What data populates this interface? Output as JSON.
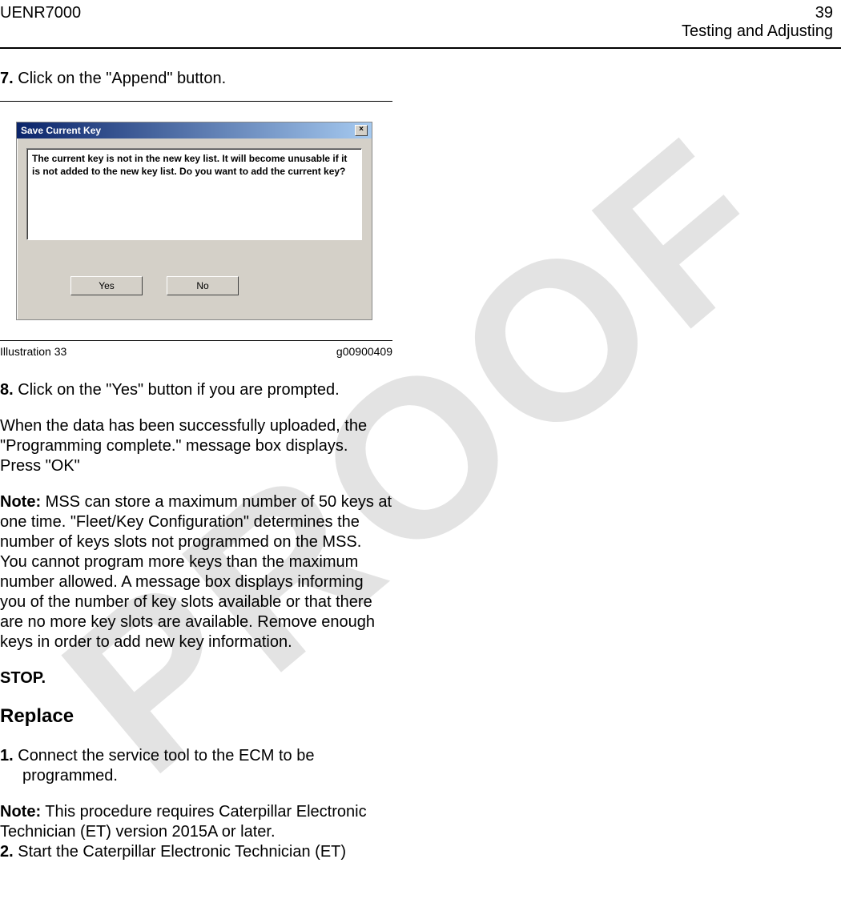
{
  "header": {
    "doc_id": "UENR7000",
    "page_number": "39",
    "section": "Testing and Adjusting"
  },
  "watermark": "PROOF",
  "step7": {
    "num": "7.",
    "text": " Click on the  \"Append\"  button."
  },
  "dialog": {
    "title": "Save Current Key",
    "close_symbol": "×",
    "message": "The current key is not in the new key list.  It will become unusable if it is not added to the new key list.  Do you want to add the current key?",
    "yes_label": "Yes",
    "no_label": "No"
  },
  "caption": {
    "left": "Illustration 33",
    "right": "g00900409"
  },
  "step8": {
    "num": "8.",
    "text": " Click on the  \"Yes\"  button if you are prompted."
  },
  "para_upload": "When the data has been successfully uploaded, the \"Programming complete.\"  message box displays. Press  \"OK\"",
  "note1_label": "Note:",
  "note1_text": " MSS can store a maximum number of 50 keys at one time.  \"Fleet/Key Configuration\"  determines the number of keys slots not programmed on the MSS. You cannot program more keys than the maximum number allowed. A message box displays informing you of the number of key slots available or that there are no more key slots are available. Remove enough keys in order to add new key information.",
  "stop": "STOP.",
  "replace_heading": "Replace",
  "step1": {
    "num": "1.",
    "text": " Connect the service tool to the ECM to be",
    "text2": "programmed."
  },
  "note2_label": "Note:",
  "note2_text": " This procedure requires Caterpillar   Electronic Technician (ET) version 2015A or later.",
  "step2": {
    "num": "2.",
    "text": " Start the Caterpillar Electronic Technician (ET)"
  }
}
